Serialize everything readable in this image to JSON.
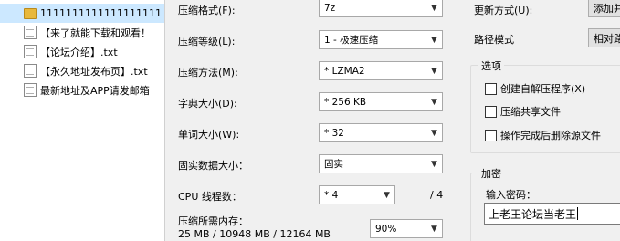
{
  "files": [
    {
      "name": "1111111111111111111",
      "type": "folder",
      "selected": true
    },
    {
      "name": "【来了就能下载和观看！",
      "type": "file"
    },
    {
      "name": "【论坛介绍】.txt",
      "type": "file"
    },
    {
      "name": "【永久地址发布页】.txt",
      "type": "file"
    },
    {
      "name": "最新地址及APP请发邮箱",
      "type": "file"
    }
  ],
  "form": {
    "format_label": "压缩格式(F):",
    "format_value": "7z",
    "level_label": "压缩等级(L):",
    "level_value": "1 - 极速压缩",
    "method_label": "压缩方法(M):",
    "method_value": "* LZMA2",
    "dict_label": "字典大小(D):",
    "dict_value": "* 256 KB",
    "word_label": "单词大小(W):",
    "word_value": "* 32",
    "solid_label": "固实数据大小：",
    "solid_value": "固实",
    "threads_label": "CPU 线程数：",
    "threads_value": "* 4",
    "threads_total": "/ 4",
    "memory_label": "压缩所需内存：",
    "memory_value": "25 MB / 10948 MB / 12164 MB",
    "memory_percent": "90%"
  },
  "right": {
    "update_label": "更新方式(U):",
    "update_value": "添加并",
    "path_label": "路径模式",
    "path_value": "相对路",
    "options_title": "选项",
    "options": [
      {
        "label": "创建自解压程序(X)",
        "checked": false
      },
      {
        "label": "压缩共享文件",
        "checked": false
      },
      {
        "label": "操作完成后删除源文件",
        "checked": false
      }
    ],
    "encrypt_title": "加密",
    "password_label": "输入密码：",
    "password_value": "上老王论坛当老王"
  },
  "icons": {
    "dropdown": "chevron-down-icon",
    "folder": "folder-icon",
    "file": "text-file-icon",
    "checkbox": "checkbox-icon"
  },
  "colors": {
    "dialog_bg": "#f0f0f0",
    "selection": "#cce8ff"
  }
}
